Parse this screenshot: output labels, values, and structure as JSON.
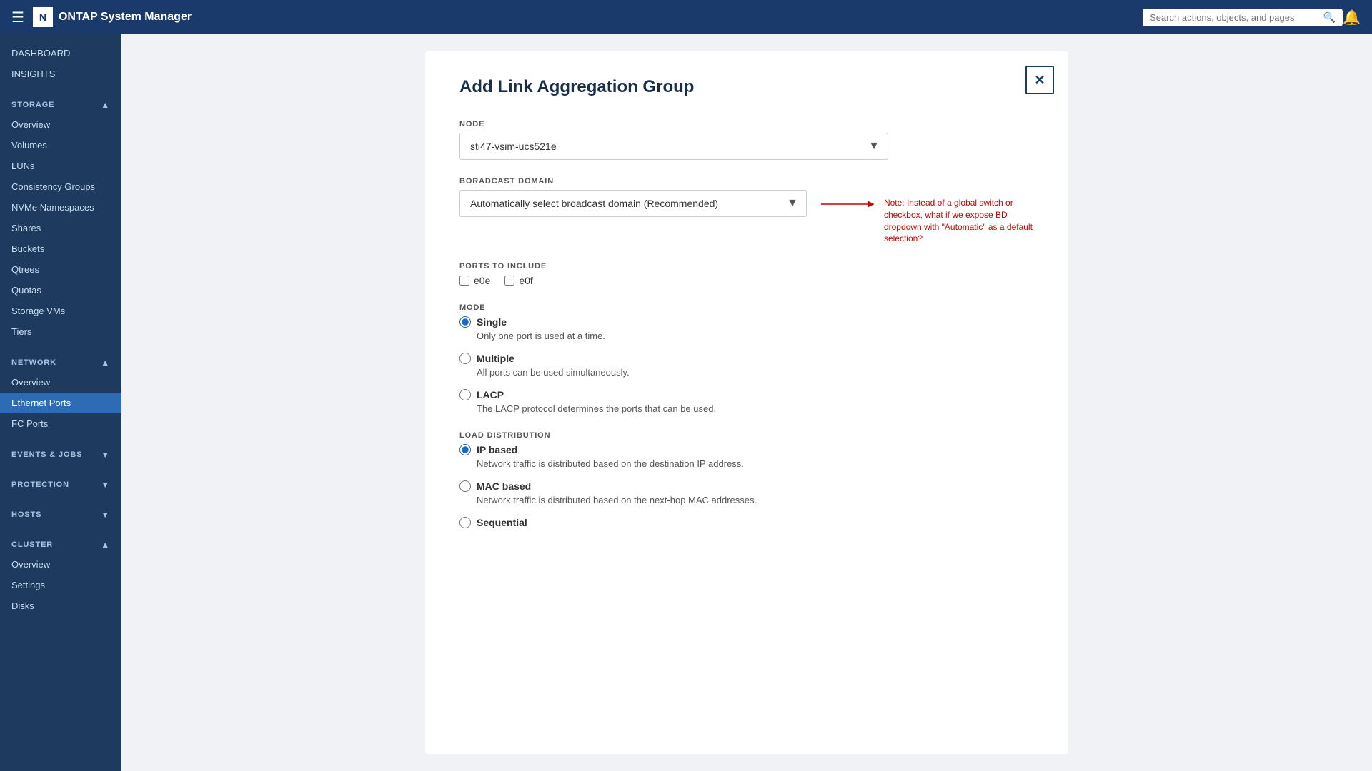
{
  "app": {
    "title": "ONTAP System Manager",
    "search_placeholder": "Search actions, objects, and pages"
  },
  "sidebar": {
    "sections": [
      {
        "id": "dashboard",
        "label": "DASHBOARD",
        "type": "link",
        "items": []
      },
      {
        "id": "insights",
        "label": "INSIGHTS",
        "type": "link",
        "items": []
      },
      {
        "id": "storage",
        "label": "STORAGE",
        "collapsible": true,
        "expanded": true,
        "items": [
          {
            "id": "storage-overview",
            "label": "Overview"
          },
          {
            "id": "storage-volumes",
            "label": "Volumes"
          },
          {
            "id": "storage-luns",
            "label": "LUNs"
          },
          {
            "id": "storage-consistency-groups",
            "label": "Consistency Groups"
          },
          {
            "id": "storage-nvme-namespaces",
            "label": "NVMe Namespaces"
          },
          {
            "id": "storage-shares",
            "label": "Shares"
          },
          {
            "id": "storage-buckets",
            "label": "Buckets"
          },
          {
            "id": "storage-qtrees",
            "label": "Qtrees"
          },
          {
            "id": "storage-quotas",
            "label": "Quotas"
          },
          {
            "id": "storage-vms",
            "label": "Storage VMs"
          },
          {
            "id": "storage-tiers",
            "label": "Tiers"
          }
        ]
      },
      {
        "id": "network",
        "label": "NETWORK",
        "collapsible": true,
        "expanded": true,
        "items": [
          {
            "id": "network-overview",
            "label": "Overview"
          },
          {
            "id": "network-ethernet-ports",
            "label": "Ethernet Ports",
            "active": true
          },
          {
            "id": "network-fc-ports",
            "label": "FC Ports"
          }
        ]
      },
      {
        "id": "events-jobs",
        "label": "EVENTS & JOBS",
        "collapsible": true,
        "expanded": false,
        "items": []
      },
      {
        "id": "protection",
        "label": "PROTECTION",
        "collapsible": true,
        "expanded": false,
        "items": []
      },
      {
        "id": "hosts",
        "label": "HOSTS",
        "collapsible": true,
        "expanded": false,
        "items": []
      },
      {
        "id": "cluster",
        "label": "CLUSTER",
        "collapsible": true,
        "expanded": true,
        "items": [
          {
            "id": "cluster-overview",
            "label": "Overview"
          },
          {
            "id": "cluster-settings",
            "label": "Settings"
          },
          {
            "id": "cluster-disks",
            "label": "Disks"
          }
        ]
      }
    ]
  },
  "dialog": {
    "title": "Add Link Aggregation Group",
    "close_label": "✕",
    "fields": {
      "node": {
        "label": "NODE",
        "value": "sti47-vsim-ucs521e",
        "options": [
          "sti47-vsim-ucs521e"
        ]
      },
      "broadcast_domain": {
        "label": "BORADCAST DOMAIN",
        "value": "Automatically select broadcast domain (Recommended)",
        "options": [
          "Automatically select broadcast domain (Recommended)"
        ],
        "note": "Note: Instead of a global switch or checkbox, what if we expose BD dropdown with \"Automatic\" as a default selection?"
      },
      "ports_to_include": {
        "label": "PORTS TO INCLUDE",
        "ports": [
          {
            "id": "e0e",
            "label": "e0e",
            "checked": false
          },
          {
            "id": "e0f",
            "label": "e0f",
            "checked": false
          }
        ]
      },
      "mode": {
        "label": "MODE",
        "options": [
          {
            "id": "single",
            "label": "Single",
            "desc": "Only one port is used at a time.",
            "checked": true
          },
          {
            "id": "multiple",
            "label": "Multiple",
            "desc": "All ports can be used simultaneously.",
            "checked": false
          },
          {
            "id": "lacp",
            "label": "LACP",
            "desc": "The LACP protocol determines the ports that can be used.",
            "checked": false
          }
        ]
      },
      "load_distribution": {
        "label": "LOAD DISTRIBUTION",
        "options": [
          {
            "id": "ip-based",
            "label": "IP based",
            "desc": "Network traffic is distributed based on the destination IP address.",
            "checked": true
          },
          {
            "id": "mac-based",
            "label": "MAC based",
            "desc": "Network traffic is distributed based on the next-hop MAC addresses.",
            "checked": false
          },
          {
            "id": "sequential",
            "label": "Sequential",
            "desc": "",
            "checked": false
          }
        ]
      }
    }
  }
}
